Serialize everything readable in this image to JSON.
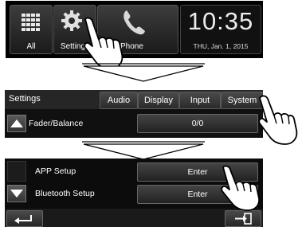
{
  "home": {
    "tiles": [
      {
        "label": "All",
        "icon": "grid-icon"
      },
      {
        "label": "Settings",
        "icon": "gear-icon"
      },
      {
        "label": "Phone",
        "icon": "phone-icon"
      }
    ],
    "clock": {
      "time": "10:35",
      "date": "THU, Jan. 1, 2015"
    }
  },
  "settings": {
    "title": "Settings",
    "tabs": [
      "Audio",
      "Display",
      "Input",
      "System"
    ],
    "row": {
      "label": "Fader/Balance",
      "value": "0/0"
    }
  },
  "system": {
    "rows": [
      {
        "label": "APP Setup",
        "value": "Enter"
      },
      {
        "label": "Bluetooth Setup",
        "value": "Enter"
      }
    ],
    "back_icon": "back-arrow-icon",
    "exit_icon": "exit-icon"
  },
  "colors": {
    "panel_bg": "#101010",
    "accent": "#6a6a6a"
  }
}
